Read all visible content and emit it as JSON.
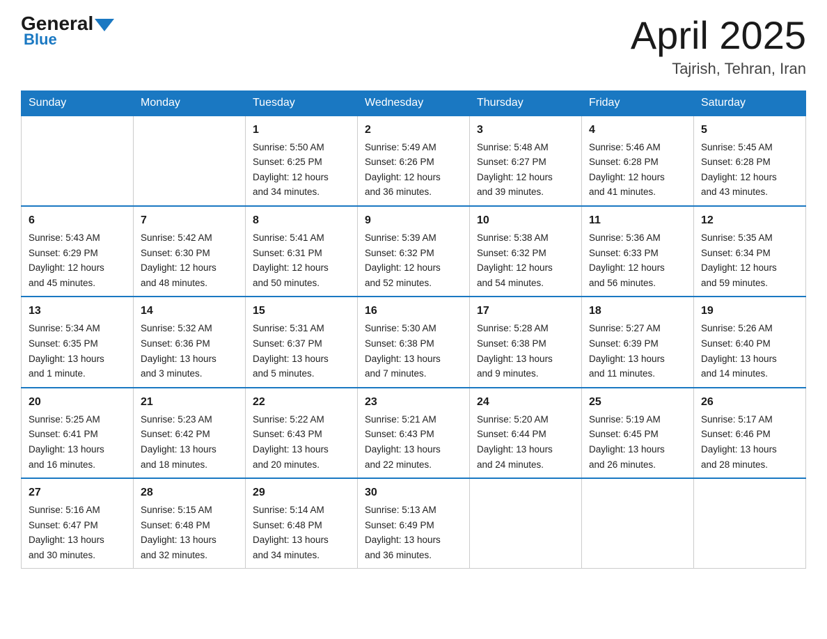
{
  "header": {
    "logo_general": "General",
    "logo_blue": "Blue",
    "month_title": "April 2025",
    "location": "Tajrish, Tehran, Iran"
  },
  "weekdays": [
    "Sunday",
    "Monday",
    "Tuesday",
    "Wednesday",
    "Thursday",
    "Friday",
    "Saturday"
  ],
  "weeks": [
    [
      {
        "day": "",
        "info": ""
      },
      {
        "day": "",
        "info": ""
      },
      {
        "day": "1",
        "info": "Sunrise: 5:50 AM\nSunset: 6:25 PM\nDaylight: 12 hours\nand 34 minutes."
      },
      {
        "day": "2",
        "info": "Sunrise: 5:49 AM\nSunset: 6:26 PM\nDaylight: 12 hours\nand 36 minutes."
      },
      {
        "day": "3",
        "info": "Sunrise: 5:48 AM\nSunset: 6:27 PM\nDaylight: 12 hours\nand 39 minutes."
      },
      {
        "day": "4",
        "info": "Sunrise: 5:46 AM\nSunset: 6:28 PM\nDaylight: 12 hours\nand 41 minutes."
      },
      {
        "day": "5",
        "info": "Sunrise: 5:45 AM\nSunset: 6:28 PM\nDaylight: 12 hours\nand 43 minutes."
      }
    ],
    [
      {
        "day": "6",
        "info": "Sunrise: 5:43 AM\nSunset: 6:29 PM\nDaylight: 12 hours\nand 45 minutes."
      },
      {
        "day": "7",
        "info": "Sunrise: 5:42 AM\nSunset: 6:30 PM\nDaylight: 12 hours\nand 48 minutes."
      },
      {
        "day": "8",
        "info": "Sunrise: 5:41 AM\nSunset: 6:31 PM\nDaylight: 12 hours\nand 50 minutes."
      },
      {
        "day": "9",
        "info": "Sunrise: 5:39 AM\nSunset: 6:32 PM\nDaylight: 12 hours\nand 52 minutes."
      },
      {
        "day": "10",
        "info": "Sunrise: 5:38 AM\nSunset: 6:32 PM\nDaylight: 12 hours\nand 54 minutes."
      },
      {
        "day": "11",
        "info": "Sunrise: 5:36 AM\nSunset: 6:33 PM\nDaylight: 12 hours\nand 56 minutes."
      },
      {
        "day": "12",
        "info": "Sunrise: 5:35 AM\nSunset: 6:34 PM\nDaylight: 12 hours\nand 59 minutes."
      }
    ],
    [
      {
        "day": "13",
        "info": "Sunrise: 5:34 AM\nSunset: 6:35 PM\nDaylight: 13 hours\nand 1 minute."
      },
      {
        "day": "14",
        "info": "Sunrise: 5:32 AM\nSunset: 6:36 PM\nDaylight: 13 hours\nand 3 minutes."
      },
      {
        "day": "15",
        "info": "Sunrise: 5:31 AM\nSunset: 6:37 PM\nDaylight: 13 hours\nand 5 minutes."
      },
      {
        "day": "16",
        "info": "Sunrise: 5:30 AM\nSunset: 6:38 PM\nDaylight: 13 hours\nand 7 minutes."
      },
      {
        "day": "17",
        "info": "Sunrise: 5:28 AM\nSunset: 6:38 PM\nDaylight: 13 hours\nand 9 minutes."
      },
      {
        "day": "18",
        "info": "Sunrise: 5:27 AM\nSunset: 6:39 PM\nDaylight: 13 hours\nand 11 minutes."
      },
      {
        "day": "19",
        "info": "Sunrise: 5:26 AM\nSunset: 6:40 PM\nDaylight: 13 hours\nand 14 minutes."
      }
    ],
    [
      {
        "day": "20",
        "info": "Sunrise: 5:25 AM\nSunset: 6:41 PM\nDaylight: 13 hours\nand 16 minutes."
      },
      {
        "day": "21",
        "info": "Sunrise: 5:23 AM\nSunset: 6:42 PM\nDaylight: 13 hours\nand 18 minutes."
      },
      {
        "day": "22",
        "info": "Sunrise: 5:22 AM\nSunset: 6:43 PM\nDaylight: 13 hours\nand 20 minutes."
      },
      {
        "day": "23",
        "info": "Sunrise: 5:21 AM\nSunset: 6:43 PM\nDaylight: 13 hours\nand 22 minutes."
      },
      {
        "day": "24",
        "info": "Sunrise: 5:20 AM\nSunset: 6:44 PM\nDaylight: 13 hours\nand 24 minutes."
      },
      {
        "day": "25",
        "info": "Sunrise: 5:19 AM\nSunset: 6:45 PM\nDaylight: 13 hours\nand 26 minutes."
      },
      {
        "day": "26",
        "info": "Sunrise: 5:17 AM\nSunset: 6:46 PM\nDaylight: 13 hours\nand 28 minutes."
      }
    ],
    [
      {
        "day": "27",
        "info": "Sunrise: 5:16 AM\nSunset: 6:47 PM\nDaylight: 13 hours\nand 30 minutes."
      },
      {
        "day": "28",
        "info": "Sunrise: 5:15 AM\nSunset: 6:48 PM\nDaylight: 13 hours\nand 32 minutes."
      },
      {
        "day": "29",
        "info": "Sunrise: 5:14 AM\nSunset: 6:48 PM\nDaylight: 13 hours\nand 34 minutes."
      },
      {
        "day": "30",
        "info": "Sunrise: 5:13 AM\nSunset: 6:49 PM\nDaylight: 13 hours\nand 36 minutes."
      },
      {
        "day": "",
        "info": ""
      },
      {
        "day": "",
        "info": ""
      },
      {
        "day": "",
        "info": ""
      }
    ]
  ]
}
